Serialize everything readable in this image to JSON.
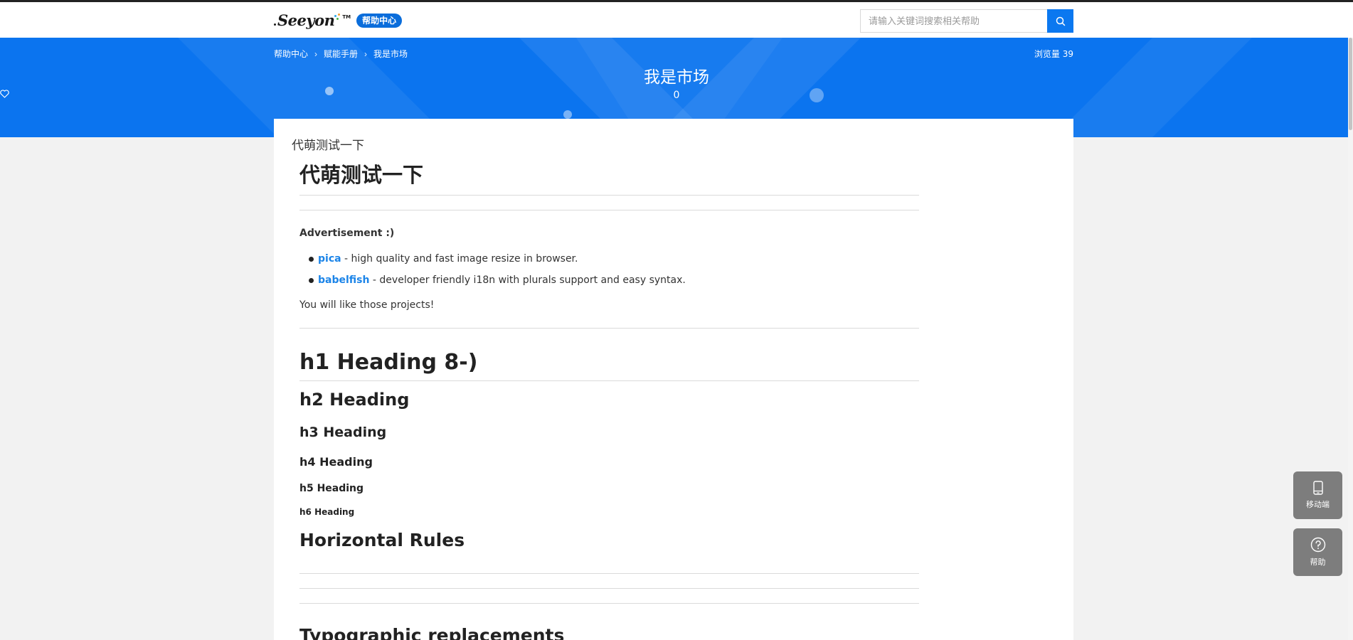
{
  "header": {
    "logo_text": "Seeyon",
    "logo_tm": "TM",
    "badge": "帮助中心",
    "search": {
      "placeholder": "请输入关键词搜索相关帮助",
      "value": ""
    },
    "search_icon": "search-icon"
  },
  "banner": {
    "breadcrumb": [
      "帮助中心",
      "赋能手册",
      "我是市场"
    ],
    "views_label": "浏览量 39",
    "title": "我是市场",
    "likes": "0",
    "like_icon": "heart-icon",
    "color": "#0b74ef"
  },
  "doc": {
    "small_title": "代萌测试一下",
    "h1_title": "代萌测试一下",
    "ad_label": "Advertisement :)",
    "ads": [
      {
        "link": "pica",
        "desc": " - high quality and fast image resize in browser."
      },
      {
        "link": "babelfish",
        "desc": " - developer friendly i18n with plurals support and easy syntax."
      }
    ],
    "like_text": "You will like those projects!",
    "h1": "h1 Heading 8-)",
    "h2": "h2 Heading",
    "h3": "h3 Heading",
    "h4": "h4 Heading",
    "h5": "h5 Heading",
    "h6": "h6 Heading",
    "rules_heading": "Horizontal Rules",
    "next_heading": "Typographic replacements",
    "link_color": "#1b84e8"
  },
  "side": {
    "mobile_label": "移动端",
    "mobile_icon": "mobile-phone-icon",
    "help_label": "帮助",
    "help_icon": "question-circle-icon"
  }
}
